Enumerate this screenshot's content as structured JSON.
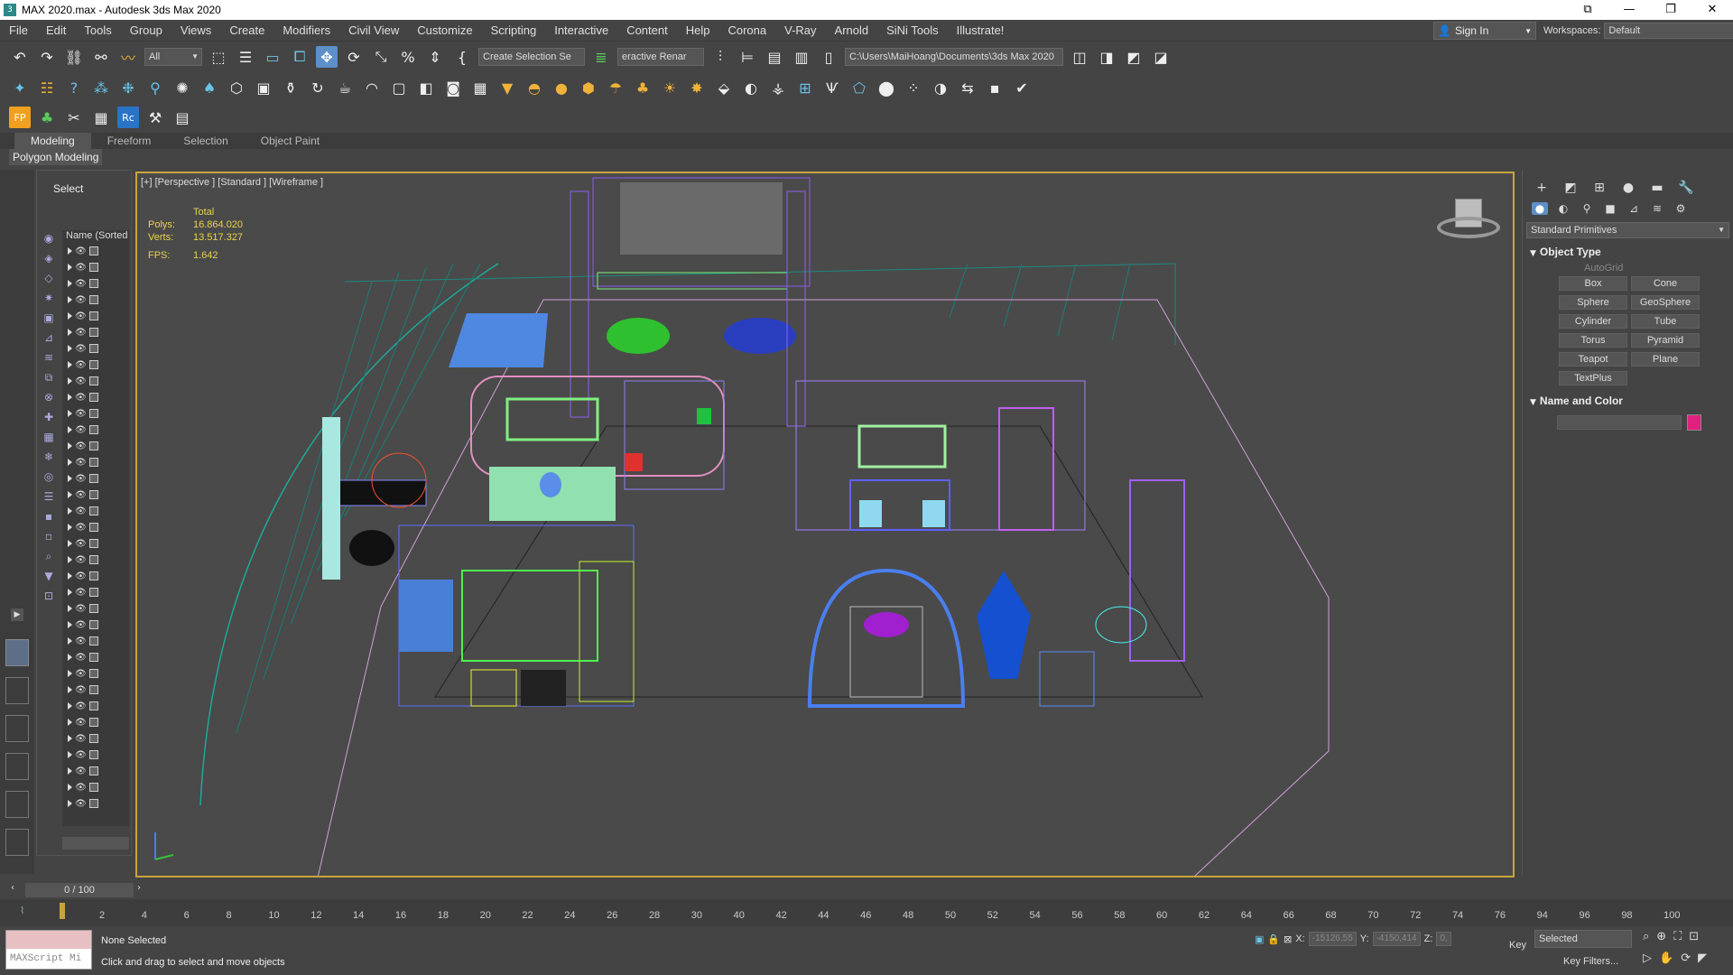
{
  "window": {
    "title": "MAX 2020.max - Autodesk 3ds Max 2020",
    "controls": [
      "—",
      "❐",
      "✕"
    ]
  },
  "menu": [
    "File",
    "Edit",
    "Tools",
    "Group",
    "Views",
    "Create",
    "Modifiers",
    "Civil View",
    "Customize",
    "Scripting",
    "Interactive",
    "Content",
    "Help",
    "Corona",
    "V-Ray",
    "Arnold",
    "SiNi Tools",
    "Illustrate!"
  ],
  "account": {
    "sign_in": "Sign In",
    "workspaces_label": "Workspaces:",
    "workspace": "Default"
  },
  "toolbar": {
    "filter": "All",
    "selection_set": "Create Selection Se",
    "interactive_label": "eractive Renar",
    "project_path": "C:\\Users\\MaiHoang\\Documents\\3ds Max 2020"
  },
  "ribbon": {
    "tabs": [
      "Modeling",
      "Freeform",
      "Selection",
      "Object Paint"
    ],
    "active": "Modeling",
    "sub": "Polygon Modeling"
  },
  "explorer": {
    "header": "Select",
    "column": "Name (Sorted A"
  },
  "viewport": {
    "label": "[+] [Perspective ] [Standard ] [Wireframe ]",
    "stats": {
      "total_label": "Total",
      "polys_label": "Polys:",
      "polys": "16.864.020",
      "verts_label": "Verts:",
      "verts": "13.517.327",
      "fps_label": "FPS:",
      "fps": "1.642"
    }
  },
  "command_panel": {
    "category": "Standard Primitives",
    "object_type_title": "Object Type",
    "autogrid": "AutoGrid",
    "primitives": [
      "Box",
      "Cone",
      "Sphere",
      "GeoSphere",
      "Cylinder",
      "Tube",
      "Torus",
      "Pyramid",
      "Teapot",
      "Plane",
      "TextPlus"
    ],
    "name_color_title": "Name and Color",
    "object_color": "#e0207e"
  },
  "time": {
    "frame": "0 / 100",
    "ticks": [
      "2",
      "4",
      "6",
      "8",
      "10",
      "12",
      "14",
      "16",
      "18",
      "20",
      "22",
      "24",
      "26",
      "28",
      "30",
      "40",
      "42",
      "44",
      "46",
      "48",
      "50",
      "52",
      "54",
      "56",
      "58",
      "60",
      "62",
      "64",
      "66",
      "68",
      "70",
      "72",
      "74",
      "76",
      "94",
      "96",
      "98",
      "100"
    ]
  },
  "status": {
    "maxscript": "MAXScript Mi",
    "selection": "None Selected",
    "prompt": "Click and drag to select and move objects",
    "x_label": "X:",
    "x": "-15126,55",
    "y_label": "Y:",
    "y": "-4150,414",
    "z_label": "Z:",
    "z": "0,",
    "key_label": "Key",
    "key_mode": "Selected",
    "key_filters": "Key Filters..."
  }
}
